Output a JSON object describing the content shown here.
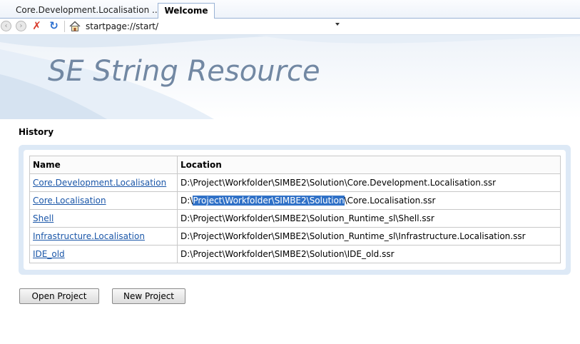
{
  "tabs": [
    {
      "label": "Core.Development.Localisation ...",
      "active": false
    },
    {
      "label": "Welcome",
      "active": true
    }
  ],
  "addressbar": {
    "url": "startpage://start/",
    "icons": [
      "back-icon",
      "forward-icon",
      "stop-icon",
      "refresh-icon",
      "home-icon",
      "dropdown-arrow-icon"
    ]
  },
  "banner": {
    "title": "SE String Resource"
  },
  "history": {
    "heading": "History",
    "columns": [
      "Name",
      "Location"
    ],
    "rows": [
      {
        "name": "Core.Development.Localisation",
        "location": "D:\\Project\\Workfolder\\SIMBE2\\Solution\\Core.Development.Localisation.ssr"
      },
      {
        "name": "Core.Localisation",
        "location_prefix": "D:\\",
        "location_selected": "Project\\Workfolder\\SIMBE2\\Solution",
        "location_suffix": "\\Core.Localisation.ssr"
      },
      {
        "name": "Shell",
        "location": "D:\\Project\\Workfolder\\SIMBE2\\Solution_Runtime_sl\\Shell.ssr"
      },
      {
        "name": "Infrastructure.Localisation",
        "location": "D:\\Project\\Workfolder\\SIMBE2\\Solution_Runtime_sl\\Infrastructure.Localisation.ssr"
      },
      {
        "name": "IDE_old",
        "location": "D:\\Project\\Workfolder\\SIMBE2\\Solution\\IDE_old.ssr"
      }
    ]
  },
  "buttons": {
    "open": "Open Project",
    "new": "New Project"
  },
  "colors": {
    "tab_border": "#9ab3d5",
    "link": "#1a56a8",
    "selection": "#3071c7",
    "banner_title": "#7288a3",
    "panel_bg": "#dde9f6"
  }
}
